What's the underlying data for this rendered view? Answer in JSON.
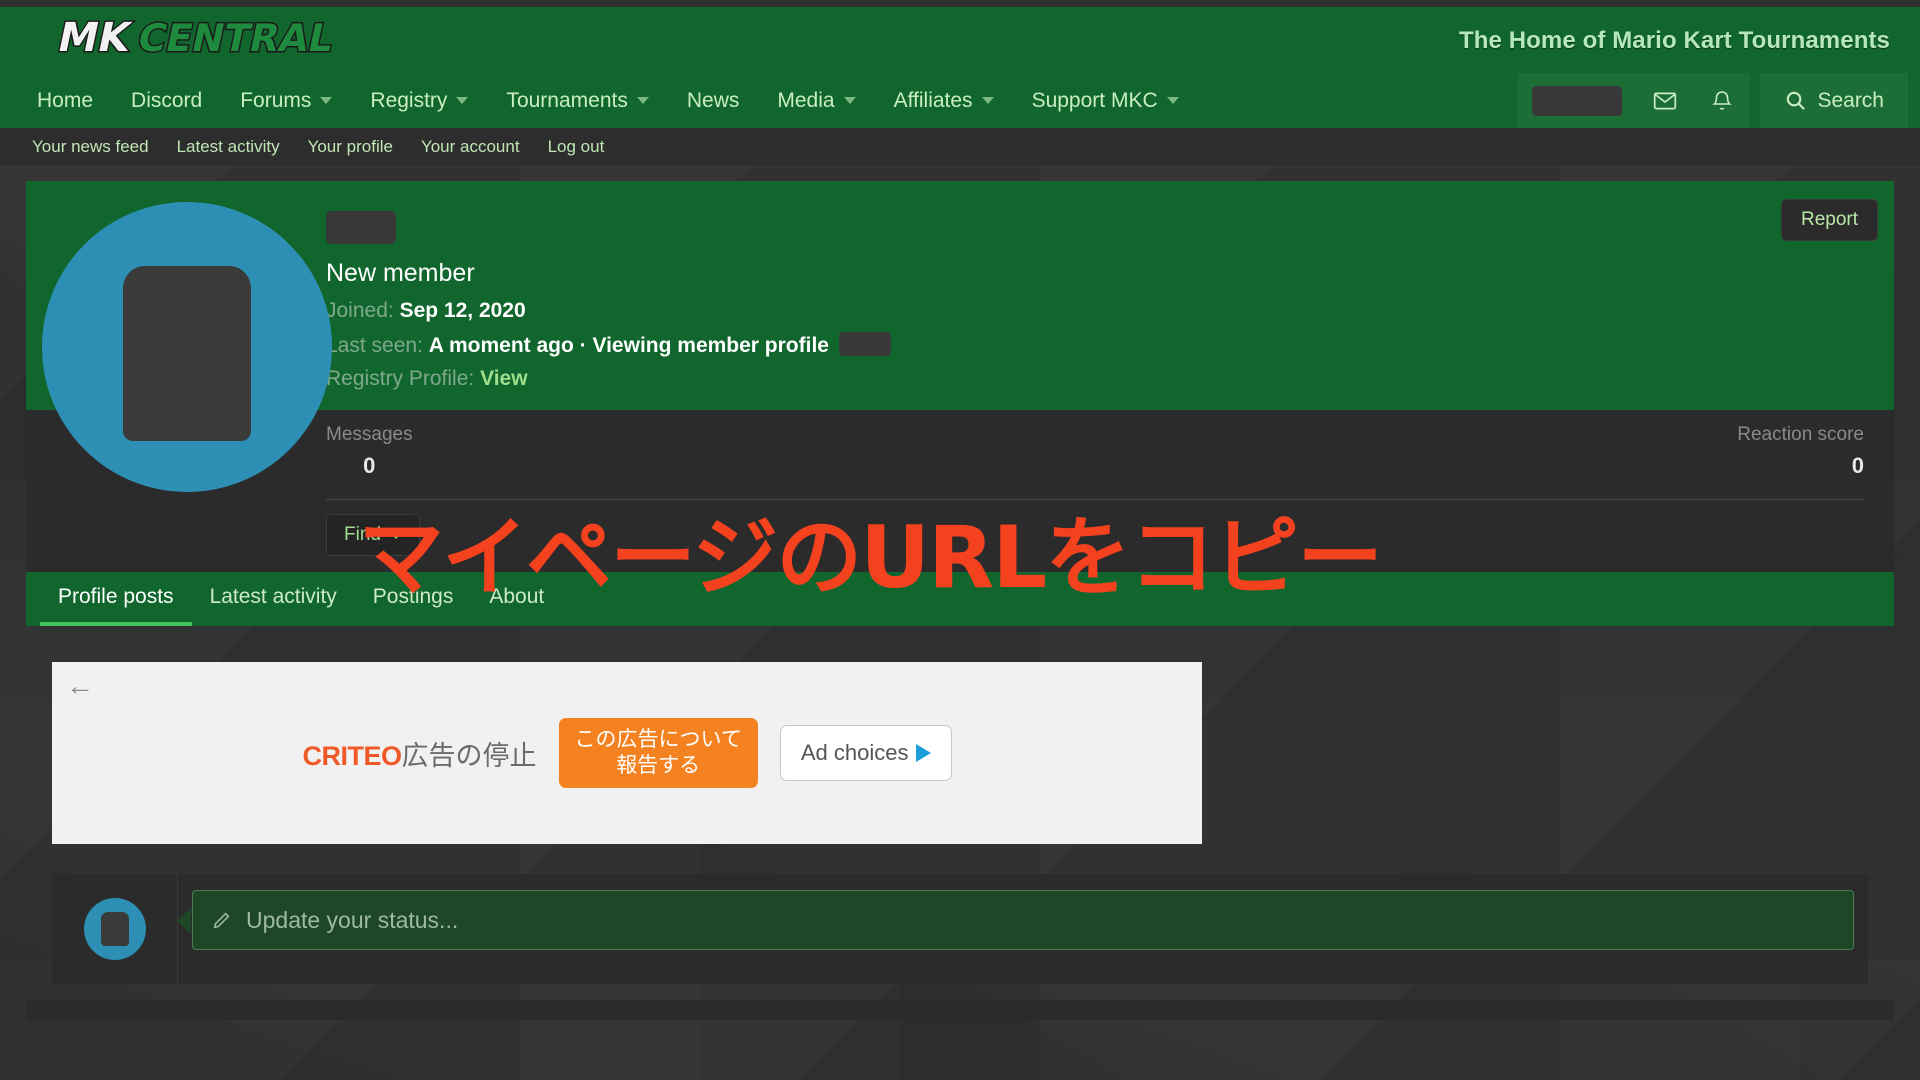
{
  "header": {
    "logo_mk": "MK",
    "logo_central": "CENTRAL",
    "tagline": "The Home of Mario Kart Tournaments"
  },
  "nav": {
    "items": [
      {
        "label": "Home",
        "has_caret": false
      },
      {
        "label": "Discord",
        "has_caret": false
      },
      {
        "label": "Forums",
        "has_caret": true
      },
      {
        "label": "Registry",
        "has_caret": true
      },
      {
        "label": "Tournaments",
        "has_caret": true
      },
      {
        "label": "News",
        "has_caret": false
      },
      {
        "label": "Media",
        "has_caret": true
      },
      {
        "label": "Affiliates",
        "has_caret": true
      },
      {
        "label": "Support MKC",
        "has_caret": true
      }
    ],
    "user_menu_label": "",
    "inbox_icon": "envelope-icon",
    "alerts_icon": "bell-icon",
    "search_label": "Search"
  },
  "subnav": {
    "items": [
      {
        "label": "Your news feed"
      },
      {
        "label": "Latest activity"
      },
      {
        "label": "Your profile"
      },
      {
        "label": "Your account"
      },
      {
        "label": "Log out"
      }
    ]
  },
  "profile": {
    "username": "",
    "user_title": "New member",
    "joined_label": "Joined:",
    "joined_value": "Sep 12, 2020",
    "last_seen_label": "Last seen:",
    "last_seen_value": "A moment ago · Viewing member profile",
    "registry_label": "Registry Profile:",
    "registry_link": "View",
    "report_label": "Report",
    "find_label": "Find",
    "stats": [
      {
        "label": "Messages",
        "value": "0"
      },
      {
        "label": "Reaction score",
        "value": "0"
      }
    ]
  },
  "tabs": [
    {
      "label": "Profile posts",
      "active": true
    },
    {
      "label": "Latest activity",
      "active": false
    },
    {
      "label": "Postings",
      "active": false
    },
    {
      "label": "About",
      "active": false
    }
  ],
  "ad": {
    "back_icon": "back-arrow-icon",
    "brand": "CRITEO",
    "brand_suffix": "広告の停止",
    "report_line1": "この広告について",
    "report_line2": "報告する",
    "choices_label": "Ad choices"
  },
  "status": {
    "pencil_icon": "pencil-icon",
    "placeholder": "Update your status..."
  },
  "annotation": {
    "text": "マイページのURLをコピー",
    "color": "#f4411e"
  },
  "colors": {
    "brand_green": "#11662d",
    "accent_green": "#3fc45a",
    "avatar_blue": "#2e8fb5",
    "page_bg": "#2f2f2f",
    "card_bg": "#2b2b2b",
    "ad_orange": "#f58220",
    "criteo_orange": "#f05a28"
  }
}
